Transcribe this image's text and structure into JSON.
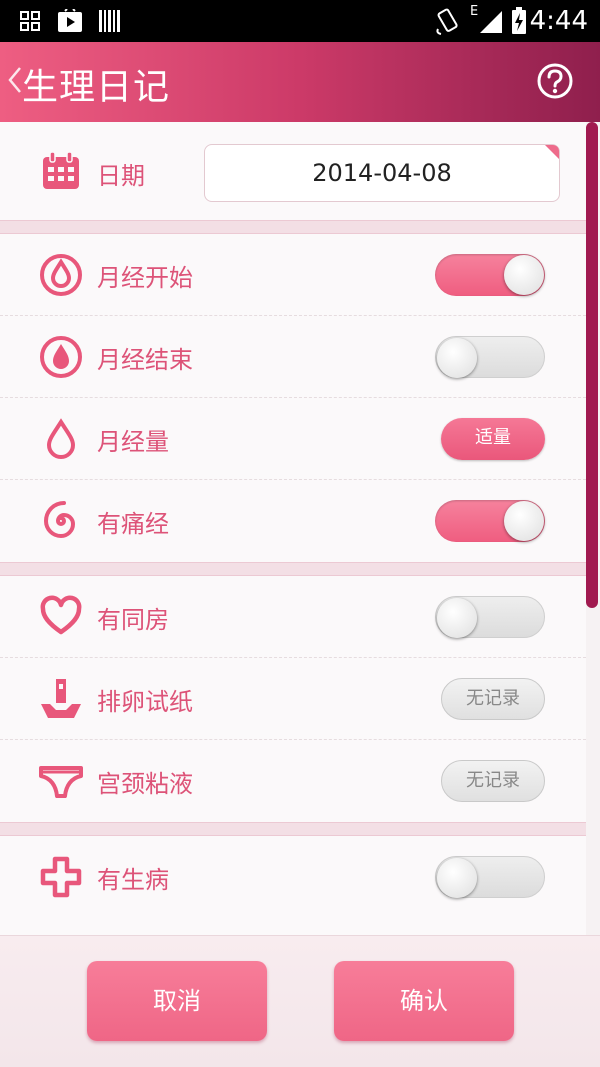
{
  "status_bar": {
    "time": "4:44",
    "network_label": "E",
    "icons": [
      "apps-grid-icon",
      "play-store-icon",
      "barcode-icon",
      "rotate-screen-icon",
      "signal-icon",
      "battery-charging-icon"
    ]
  },
  "header": {
    "title": "生理日记",
    "back_icon": "chevron-left-icon",
    "help_icon": "question-circle-icon"
  },
  "date": {
    "label": "日期",
    "value": "2014-04-08",
    "icon": "calendar-icon"
  },
  "rows": [
    {
      "label": "月经开始",
      "icon": "drop-circle-icon",
      "control": "toggle",
      "on": true
    },
    {
      "label": "月经结束",
      "icon": "drop-circle-icon",
      "control": "toggle",
      "on": false
    },
    {
      "label": "月经量",
      "icon": "drop-icon",
      "control": "pill",
      "value": "适量"
    },
    {
      "label": "有痛经",
      "icon": "spiral-icon",
      "control": "toggle",
      "on": true
    },
    {
      "label": "有同房",
      "icon": "heart-icon",
      "control": "toggle",
      "on": false
    },
    {
      "label": "排卵试纸",
      "icon": "test-strip-icon",
      "control": "pill",
      "value": "无记录"
    },
    {
      "label": "宫颈粘液",
      "icon": "underwear-icon",
      "control": "pill",
      "value": "无记录"
    },
    {
      "label": "有生病",
      "icon": "plus-cross-icon",
      "control": "toggle",
      "on": false
    }
  ],
  "footer": {
    "cancel_label": "取消",
    "confirm_label": "确认"
  },
  "colors": {
    "accent": "#ee6b8b",
    "header_start": "#ee5e82",
    "header_end": "#8f1f4d",
    "label_pink": "#dd5378"
  }
}
